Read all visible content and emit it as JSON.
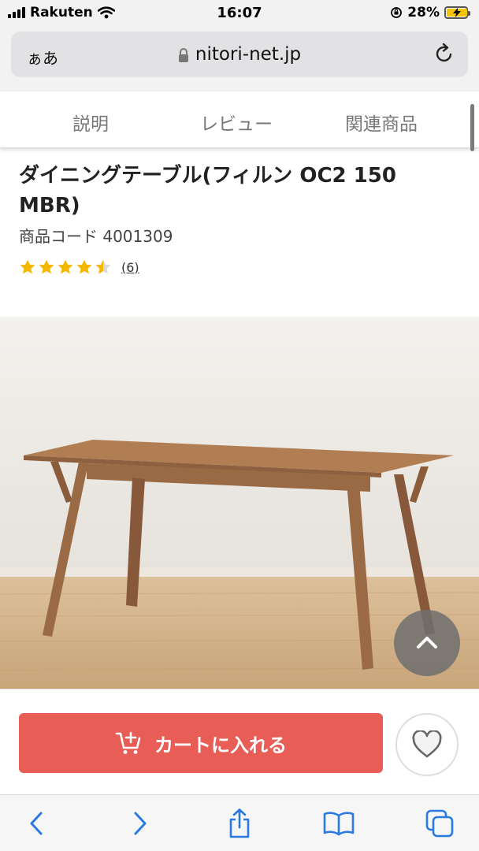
{
  "status_bar": {
    "carrier": "Rakuten",
    "time": "16:07",
    "battery_percent": "28%"
  },
  "browser": {
    "text_size_label": "ぁあ",
    "url": "nitori-net.jp"
  },
  "tabs": [
    {
      "label": "説明"
    },
    {
      "label": "レビュー"
    },
    {
      "label": "関連商品"
    }
  ],
  "product": {
    "title": "ダイニングテーブル(フィルン OC2 150 MBR)",
    "code": "商品コード  4001309",
    "rating_value": 4.5,
    "review_count": "(6)"
  },
  "cart": {
    "add_to_cart_label": "カートに入れる"
  },
  "colors": {
    "cart_button": "#e85d55",
    "star": "#f5b800",
    "ios_blue": "#2a7ae2"
  },
  "icons": [
    "signal-icon",
    "wifi-icon",
    "lock-icon",
    "battery-icon",
    "reload-icon",
    "star-icon",
    "chevron-up-icon",
    "cart-plus-icon",
    "heart-icon",
    "back-icon",
    "forward-icon",
    "share-icon",
    "bookmarks-icon",
    "tabs-icon"
  ]
}
